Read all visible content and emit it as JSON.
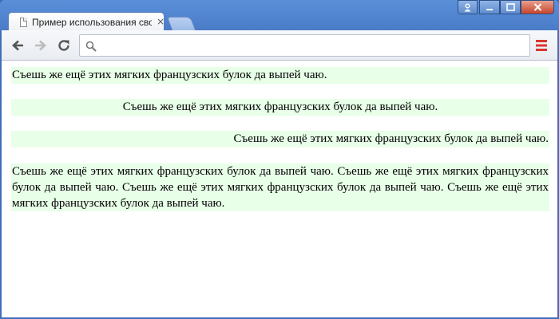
{
  "tab": {
    "title": "Пример использования сво",
    "close_glyph": "×"
  },
  "paragraphs": {
    "left": "Съешь же ещё этих мягких французских булок да выпей чаю.",
    "center": "Съешь же ещё этих мягких французских булок да выпей чаю.",
    "right": "Съешь же ещё этих мягких французских булок да выпей чаю.",
    "justify": "Съешь же ещё этих мягких французских булок да выпей чаю. Съешь же ещё этих мягких французских булок да выпей чаю. Съешь же ещё этих мягких французских булок да выпей чаю. Съешь же ещё этих мягких французских булок да выпей чаю."
  },
  "omnibox": {
    "value": ""
  },
  "colors": {
    "paragraph_background": "#e8ffe8",
    "window_frame": "#4a7cc8",
    "menu_icon": "#d9372f"
  },
  "icons": [
    "user-icon",
    "minimize-icon",
    "maximize-icon",
    "close-icon",
    "back-icon",
    "forward-icon",
    "reload-icon",
    "search-icon",
    "menu-icon",
    "document-icon"
  ]
}
